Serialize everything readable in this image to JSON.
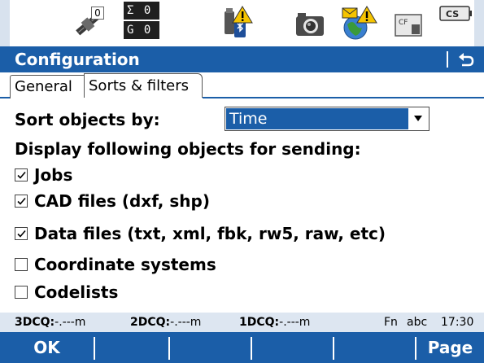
{
  "status_bar": {
    "satellite_count": "0",
    "counts_top": "Σ 0",
    "counts_bottom": "G 0",
    "icons": [
      "satellite-icon",
      "gnss-bluetooth-icon",
      "camera-icon",
      "internet-globe-icon",
      "cf-card-icon",
      "battery-cs-icon"
    ],
    "battery_label": "CS"
  },
  "title_bar": {
    "title": "Configuration",
    "back_icon": "return-arrow-icon"
  },
  "tabs": [
    {
      "label": "General",
      "active": false
    },
    {
      "label": "Sorts & filters",
      "active": true
    }
  ],
  "form": {
    "sort_label": "Sort objects by:",
    "sort_value": "Time",
    "display_label": "Display following objects for sending:",
    "checkboxes": [
      {
        "label": "Jobs",
        "checked": true
      },
      {
        "label": "CAD files (dxf, shp)",
        "checked": true
      },
      {
        "label": "Data files (txt, xml, fbk, rw5, raw, etc)",
        "checked": true
      },
      {
        "label": "Coordinate systems",
        "checked": false
      },
      {
        "label": "Codelists",
        "checked": false
      }
    ]
  },
  "quality_bar": {
    "q3_label": "3DCQ:",
    "q3_value": "-.---m",
    "q2_label": "2DCQ:",
    "q2_value": "-.---m",
    "q1_label": "1DCQ:",
    "q1_value": "-.---m",
    "fn": "Fn",
    "mode": "abc",
    "time": "17:30"
  },
  "function_keys": {
    "f1": "OK",
    "f6": "Page"
  },
  "colors": {
    "accent_blue": "#1b5ea8",
    "info_bar": "#dde6f1",
    "warning_yellow": "#f5c400"
  }
}
